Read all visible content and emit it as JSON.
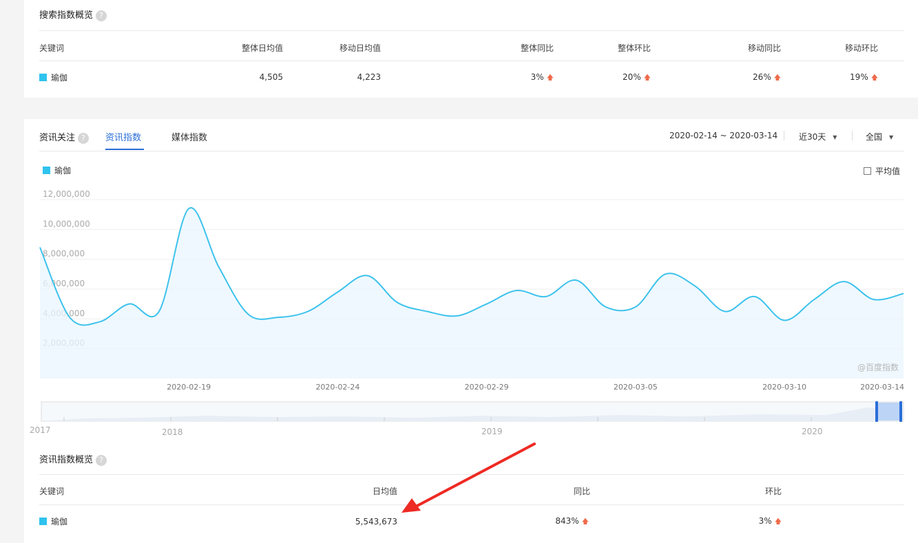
{
  "search_overview": {
    "title": "搜索指数概览",
    "help": "?",
    "headers": {
      "keyword": "关键词",
      "overall_avg": "整体日均值",
      "mobile_avg": "移动日均值",
      "overall_yoy": "整体同比",
      "overall_mom": "整体环比",
      "mobile_yoy": "移动同比",
      "mobile_mom": "移动环比"
    },
    "row": {
      "keyword": "瑜伽",
      "overall_avg": "4,505",
      "mobile_avg": "4,223",
      "overall_yoy": "3%",
      "overall_mom": "20%",
      "mobile_yoy": "26%",
      "mobile_mom": "19%"
    },
    "up_glyph": "🡅"
  },
  "news": {
    "section_title": "资讯关注",
    "help": "?",
    "tabs": [
      "资讯指数",
      "媒体指数"
    ],
    "date_range": "2020-02-14 ~ 2020-03-14",
    "period_select": "近30天",
    "region_select": "全国",
    "legend_label": "瑜伽",
    "avg_checkbox_label": "平均值",
    "watermark": "@百度指数",
    "accent_color": "#2fc3ee",
    "tab_active_color": "#2a6ed8"
  },
  "chart_data": {
    "type": "area",
    "series_color": "#3cc2ec",
    "y_ticks": [
      2000000,
      4000000,
      6000000,
      8000000,
      10000000,
      12000000
    ],
    "y_tick_labels": [
      "2,000,000",
      "4,000,000",
      "6,000,000",
      "8,000,000",
      "10,000,000",
      "12,000,000"
    ],
    "ylim": [
      0,
      12600000
    ],
    "x_tick_labels": [
      "2020-02-19",
      "2020-02-24",
      "2020-02-29",
      "2020-03-05",
      "2020-03-10",
      "2020-03-14"
    ],
    "x_tick_index": [
      5,
      10,
      15,
      20,
      25,
      29
    ],
    "categories": [
      "2020-02-14",
      "2020-02-15",
      "2020-02-16",
      "2020-02-17",
      "2020-02-18",
      "2020-02-19",
      "2020-02-20",
      "2020-02-21",
      "2020-02-22",
      "2020-02-23",
      "2020-02-24",
      "2020-02-25",
      "2020-02-26",
      "2020-02-27",
      "2020-02-28",
      "2020-02-29",
      "2020-03-01",
      "2020-03-02",
      "2020-03-03",
      "2020-03-04",
      "2020-03-05",
      "2020-03-06",
      "2020-03-07",
      "2020-03-08",
      "2020-03-09",
      "2020-03-10",
      "2020-03-11",
      "2020-03-12",
      "2020-03-13",
      "2020-03-14"
    ],
    "series": [
      {
        "values": [
          8800000,
          4100000,
          3800000,
          5000000,
          4500000,
          11400000,
          7500000,
          4300000,
          4100000,
          4500000,
          5800000,
          6900000,
          5100000,
          4500000,
          4200000,
          5000000,
          5900000,
          5500000,
          6600000,
          4800000,
          4800000,
          7000000,
          6200000,
          4500000,
          5500000,
          3900000,
          5300000,
          6500000,
          5300000,
          5700000
        ]
      }
    ],
    "grid": true
  },
  "timeline": {
    "year_labels": [
      "2017",
      "2018",
      "2019",
      "2020"
    ]
  },
  "news_overview": {
    "title": "资讯指数概览",
    "help": "?",
    "headers": {
      "keyword": "关键词",
      "daily_avg": "日均值",
      "yoy": "同比",
      "mom": "环比"
    },
    "row": {
      "keyword": "瑜伽",
      "daily_avg": "5,543,673",
      "yoy": "843%",
      "mom": "3%"
    }
  }
}
